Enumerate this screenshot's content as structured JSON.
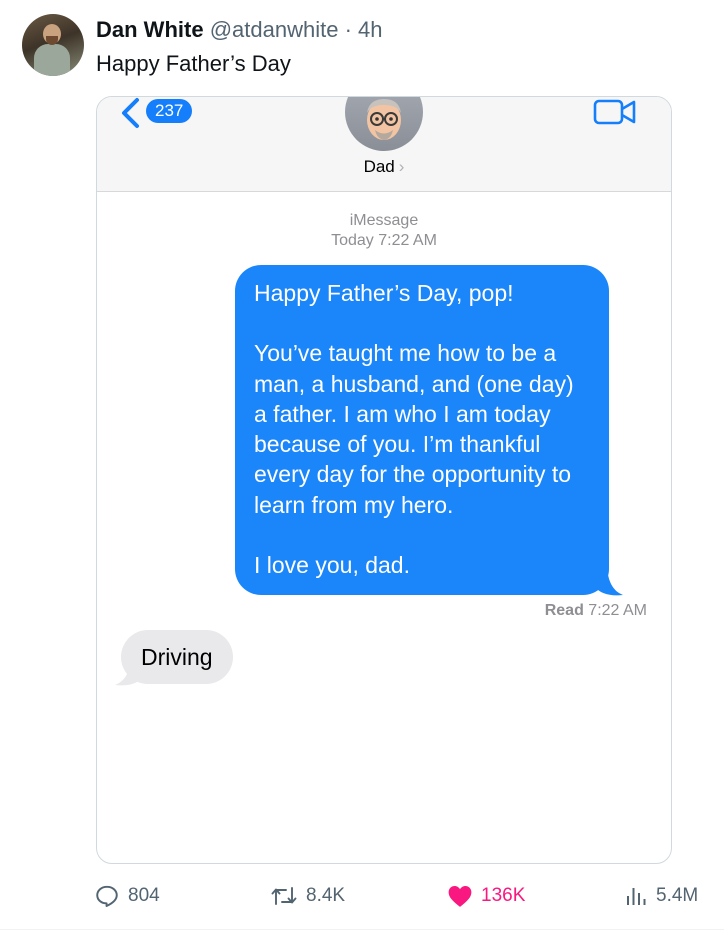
{
  "tweet": {
    "display_name": "Dan White",
    "handle": "@atdanwhite",
    "separator": "·",
    "time": "4h",
    "text": "Happy Father’s Day"
  },
  "imessage": {
    "back_count": "237",
    "contact_name": "Dad",
    "contact_chevron": "›",
    "service_label": "iMessage",
    "timestamp": "Today 7:22 AM",
    "outgoing_message": {
      "paragraph_1": "Happy Father’s Day, pop!",
      "paragraph_2": "You’ve taught me how to be a man, a husband, and (one day) a father. I am who I am today because of you. I’m thankful every day for the opportunity to learn from my hero.",
      "paragraph_3": "I love you, dad."
    },
    "read_label": "Read",
    "read_time": "7:22 AM",
    "incoming_message": "Driving",
    "colors": {
      "outgoing_bubble": "#1b86f9",
      "incoming_bubble": "#e9e9eb",
      "accent": "#147efb"
    }
  },
  "actions": {
    "replies": "804",
    "reposts": "8.4K",
    "likes": "136K",
    "views": "5.4M",
    "icons": [
      "reply-icon",
      "retweet-icon",
      "heart-icon",
      "views-icon"
    ],
    "like_color": "#f91880"
  }
}
